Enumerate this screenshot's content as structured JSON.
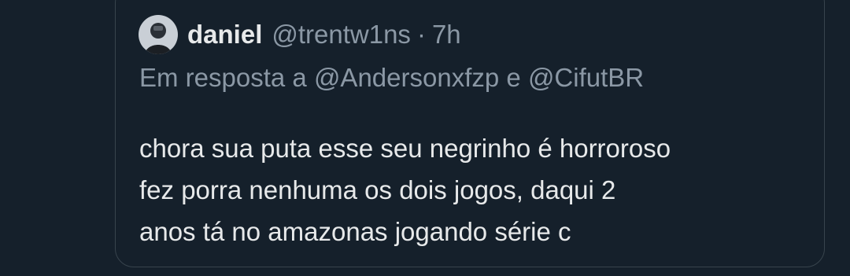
{
  "colors": {
    "background": "#15202b",
    "border": "#38444d",
    "primary_text": "#e7e9ea",
    "secondary_text": "#8b98a5"
  },
  "quoted_tweet": {
    "author": {
      "display_name": "daniel",
      "handle": "@trentw1ns",
      "separator": "·",
      "time": "7h",
      "avatar_icon": "user-avatar"
    },
    "reply_context": {
      "prefix": "Em resposta a",
      "mention_1": "@Andersonxfzp",
      "conjunction": "e",
      "mention_2": "@CifutBR"
    },
    "text_lines": [
      "chora sua puta esse seu negrinho é horroroso",
      "fez porra nenhuma os dois jogos, daqui 2",
      "anos tá no amazonas jogando série c"
    ]
  }
}
